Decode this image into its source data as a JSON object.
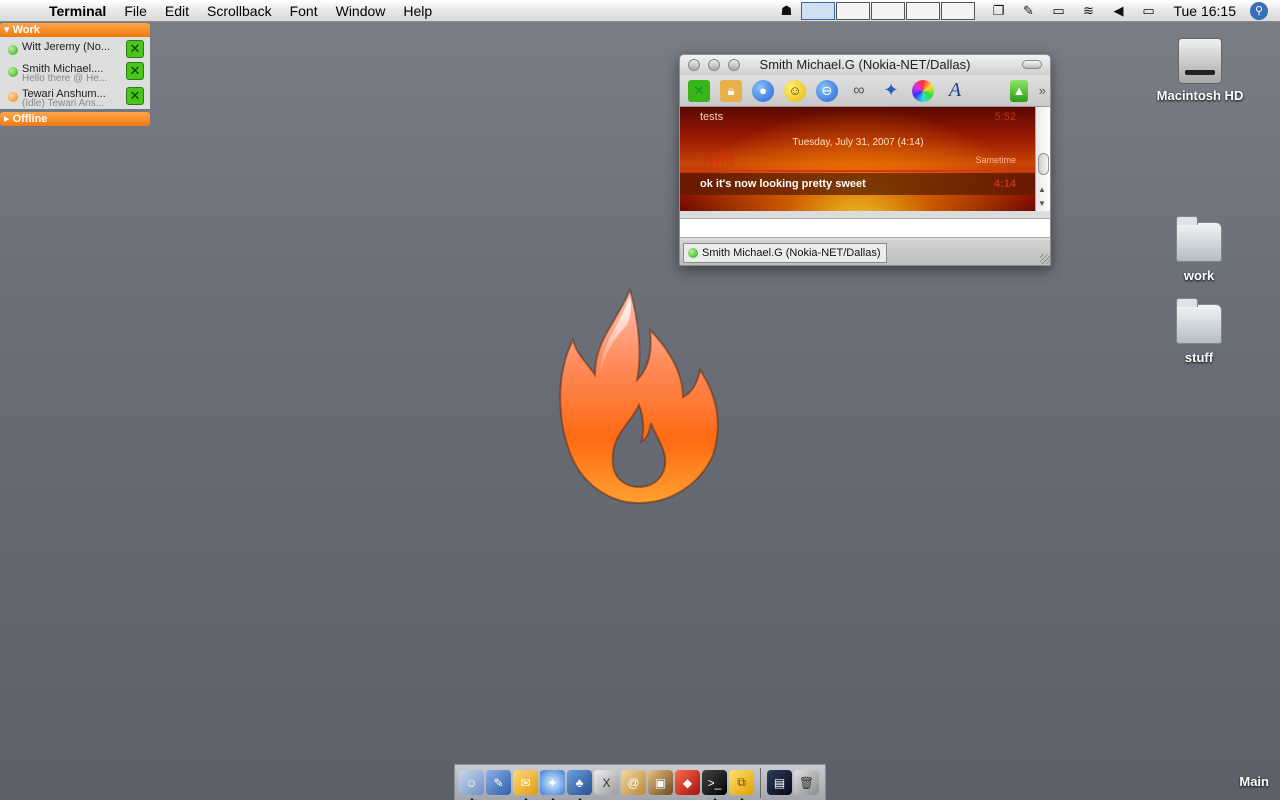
{
  "menubar": {
    "app_name": "Terminal",
    "items": [
      "File",
      "Edit",
      "Scrollback",
      "Font",
      "Window",
      "Help"
    ],
    "clock": "Tue 16:15",
    "icons": [
      "gnome-menu-icon",
      "spaces-icon",
      "window-icon",
      "status-icon",
      "display-icon",
      "wifi-icon",
      "volume-icon",
      "battery-icon",
      "spotlight-icon"
    ]
  },
  "buddylist": {
    "group_work": "Work",
    "group_offline": "Offline",
    "buddies": [
      {
        "name": "Witt Jeremy (No...",
        "sub": "",
        "status": "available"
      },
      {
        "name": "Smith Michael....",
        "sub": "Hello there  @ He...",
        "status": "available"
      },
      {
        "name": "Tewari Anshum...",
        "sub": "(Idle) Tewari Ans...",
        "status": "idle"
      }
    ]
  },
  "chat": {
    "title": "Smith Michael.G (Nokia-NET/Dallas)",
    "messages": {
      "m1_text": "tests",
      "m1_time": "5:52",
      "date_header": "Tuesday, July 31, 2007 (4:14)",
      "sender": "JWitt",
      "service": "Sametime",
      "m3_text": "ok it's now looking pretty sweet",
      "m3_time": "4:14"
    },
    "tab_label": "Smith Michael.G (Nokia-NET/Dallas)"
  },
  "desktop": {
    "hd_label": "Macintosh HD",
    "folders": [
      "work",
      "stuff"
    ],
    "space_label": "Main"
  },
  "colors": {
    "accent_orange": "#f07a10",
    "online_green": "#29a80b"
  }
}
